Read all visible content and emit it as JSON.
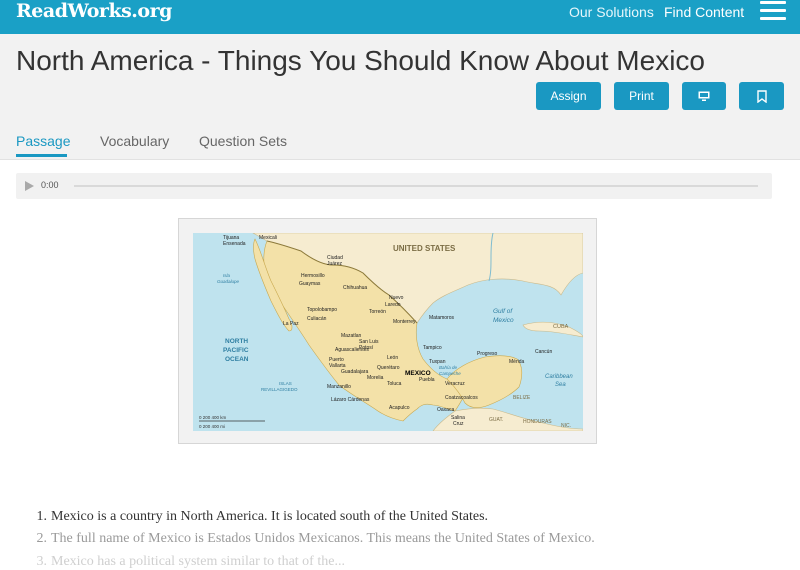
{
  "topbar": {
    "logo": "ReadWorks.org",
    "nav": {
      "solutions": "Our Solutions",
      "find_content": "Find Content"
    }
  },
  "header": {
    "title": "North America - Things You Should Know About Mexico",
    "buttons": {
      "assign": "Assign",
      "print": "Print"
    }
  },
  "tabs": {
    "passage": "Passage",
    "vocabulary": "Vocabulary",
    "question_sets": "Question Sets"
  },
  "audio": {
    "time": "0:00"
  },
  "map": {
    "labels": {
      "usa": "UNITED STATES",
      "mexico": "MEXICO",
      "north_pacific": "NORTH",
      "pacific": "PACIFIC",
      "ocean": "OCEAN",
      "gulf1": "Gulf of",
      "gulf2": "Mexico",
      "caribbean1": "Caribbean",
      "caribbean2": "Sea",
      "cuba": "CUBA",
      "belize": "BELIZE",
      "guat": "GUAT.",
      "honduras": "HONDURAS",
      "nic": "NIC.",
      "islas1": "ISLAS",
      "islas2": "REVILLAGIGEDO",
      "isla1": "Isla",
      "isla2": "Guadalupe",
      "bahia1": "Bahía de",
      "bahia2": "Campeche"
    },
    "cities": [
      "Tijuana",
      "Mexicali",
      "Ensenada",
      "Ciudad",
      "Juárez",
      "Hermosillo",
      "Guaymas",
      "Chihuahua",
      "Topolobampo",
      "Culiacán",
      "Nuevo",
      "Laredo",
      "Torreón",
      "Monterrey",
      "Matamoros",
      "La Paz",
      "Mazatlan",
      "San Luis",
      "Potosí",
      "Tampico",
      "Aguascalientes",
      "León",
      "Progreso",
      "Mérida",
      "Cancún",
      "Puerto",
      "Vallarta",
      "Guadalajara",
      "Querétaro",
      "Tuxpan",
      "Morelia",
      "Toluca",
      "Puebla",
      "Veracruz",
      "Manzanillo",
      "Lázaro Cárdenas",
      "Coatzacoalcos",
      "Acapulco",
      "Oaxaca",
      "Salina",
      "Cruz"
    ],
    "scale": {
      "km": "0    200    400 km",
      "mi": "0        200        400 mi"
    }
  },
  "passage": {
    "lines": [
      {
        "num": "1.",
        "text": "Mexico is a country in North America. It is located south of the United States."
      },
      {
        "num": "2.",
        "text": "The full name of Mexico is Estados Unidos Mexicanos. This means the United States of Mexico."
      },
      {
        "num": "3.",
        "text": "Mexico has a political system similar to that of the..."
      }
    ]
  }
}
